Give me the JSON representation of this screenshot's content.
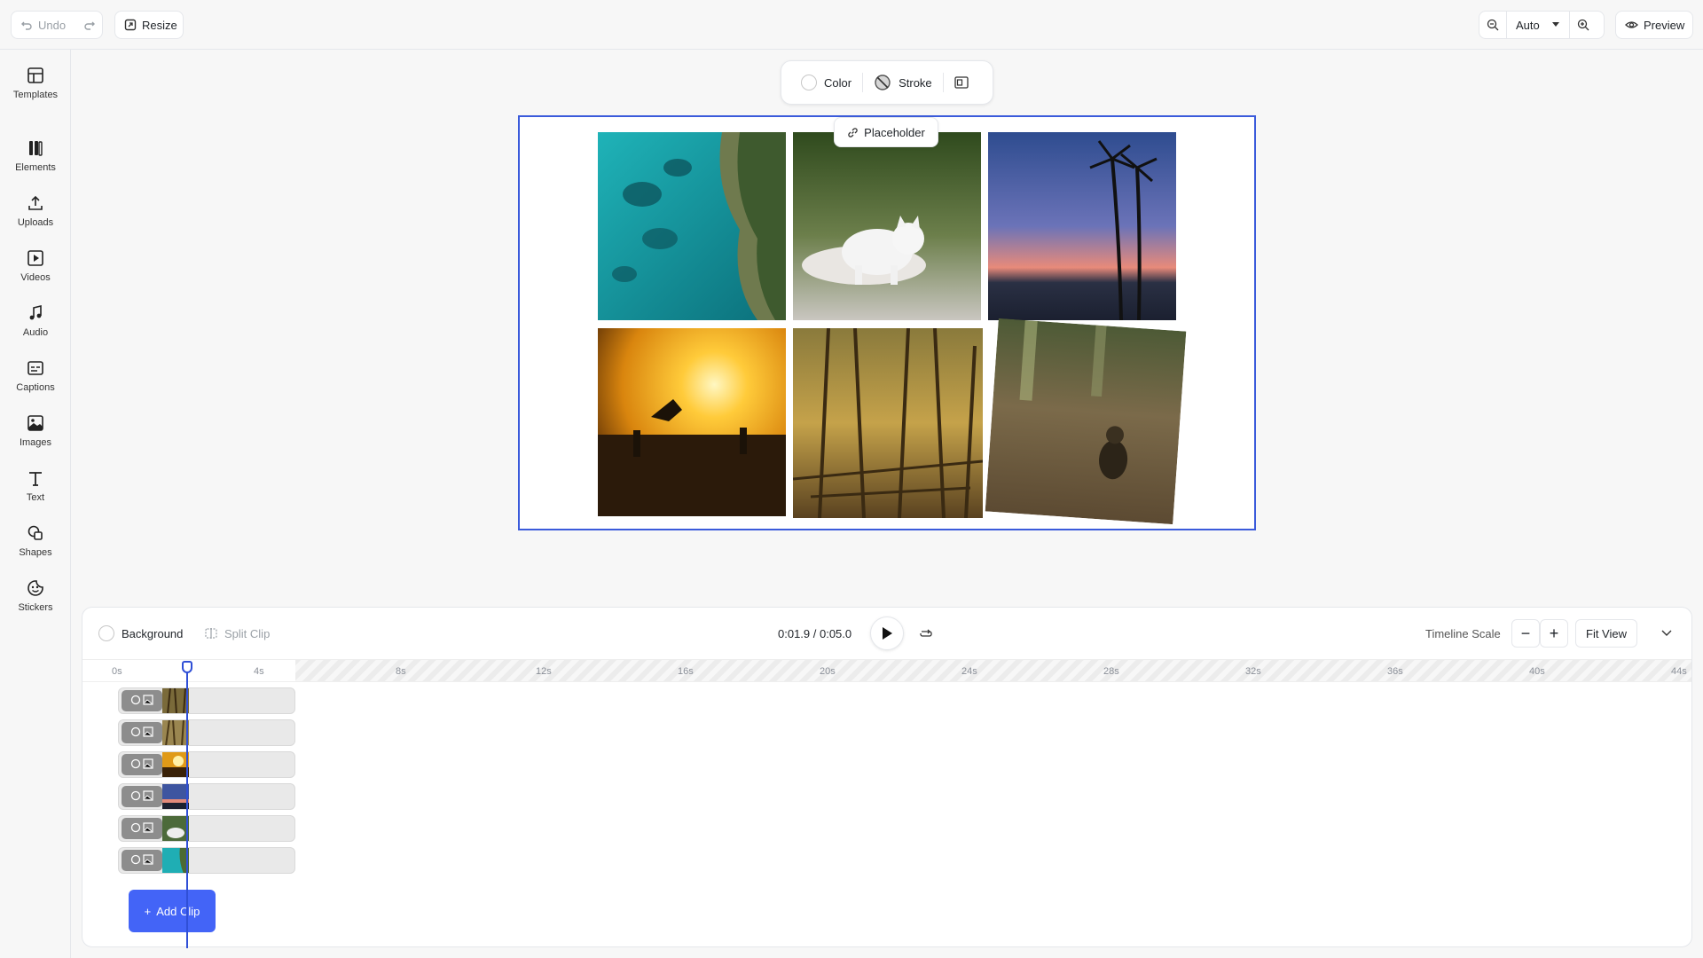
{
  "topbar": {
    "undo_label": "Undo",
    "resize_label": "Resize",
    "zoom_value": "Auto",
    "preview_label": "Preview"
  },
  "sidebar": {
    "items": [
      {
        "label": "Templates",
        "icon": "templates-icon"
      },
      {
        "label": "Elements",
        "icon": "elements-icon"
      },
      {
        "label": "Uploads",
        "icon": "upload-icon"
      },
      {
        "label": "Videos",
        "icon": "video-icon"
      },
      {
        "label": "Audio",
        "icon": "music-note-icon"
      },
      {
        "label": "Captions",
        "icon": "captions-icon"
      },
      {
        "label": "Images",
        "icon": "image-icon"
      },
      {
        "label": "Text",
        "icon": "text-icon"
      },
      {
        "label": "Shapes",
        "icon": "shapes-icon"
      },
      {
        "label": "Stickers",
        "icon": "sticker-icon"
      }
    ]
  },
  "element_toolbar": {
    "color_label": "Color",
    "stroke_label": "Stroke"
  },
  "canvas": {
    "placeholder_label": "Placeholder",
    "photos": [
      "aerial coast",
      "white kitten",
      "palm trees sunset",
      "skateboarder sunset",
      "forest",
      "monkey"
    ]
  },
  "timeline": {
    "background_label": "Background",
    "split_clip_label": "Split Clip",
    "time_display": "0:01.9 / 0:05.0",
    "scale_label": "Timeline Scale",
    "fit_view_label": "Fit View",
    "ticks": [
      "0s",
      "4s",
      "8s",
      "12s",
      "16s",
      "20s",
      "24s",
      "28s",
      "32s",
      "36s",
      "40s",
      "44s"
    ],
    "add_clip_label": "Add Clip",
    "tracks": [
      "forest clip",
      "forest clip 2",
      "sunset clip",
      "palm clip",
      "kitten clip",
      "coast clip"
    ]
  },
  "colors": {
    "accent": "#4364f7",
    "selection": "#3b5bdb"
  }
}
